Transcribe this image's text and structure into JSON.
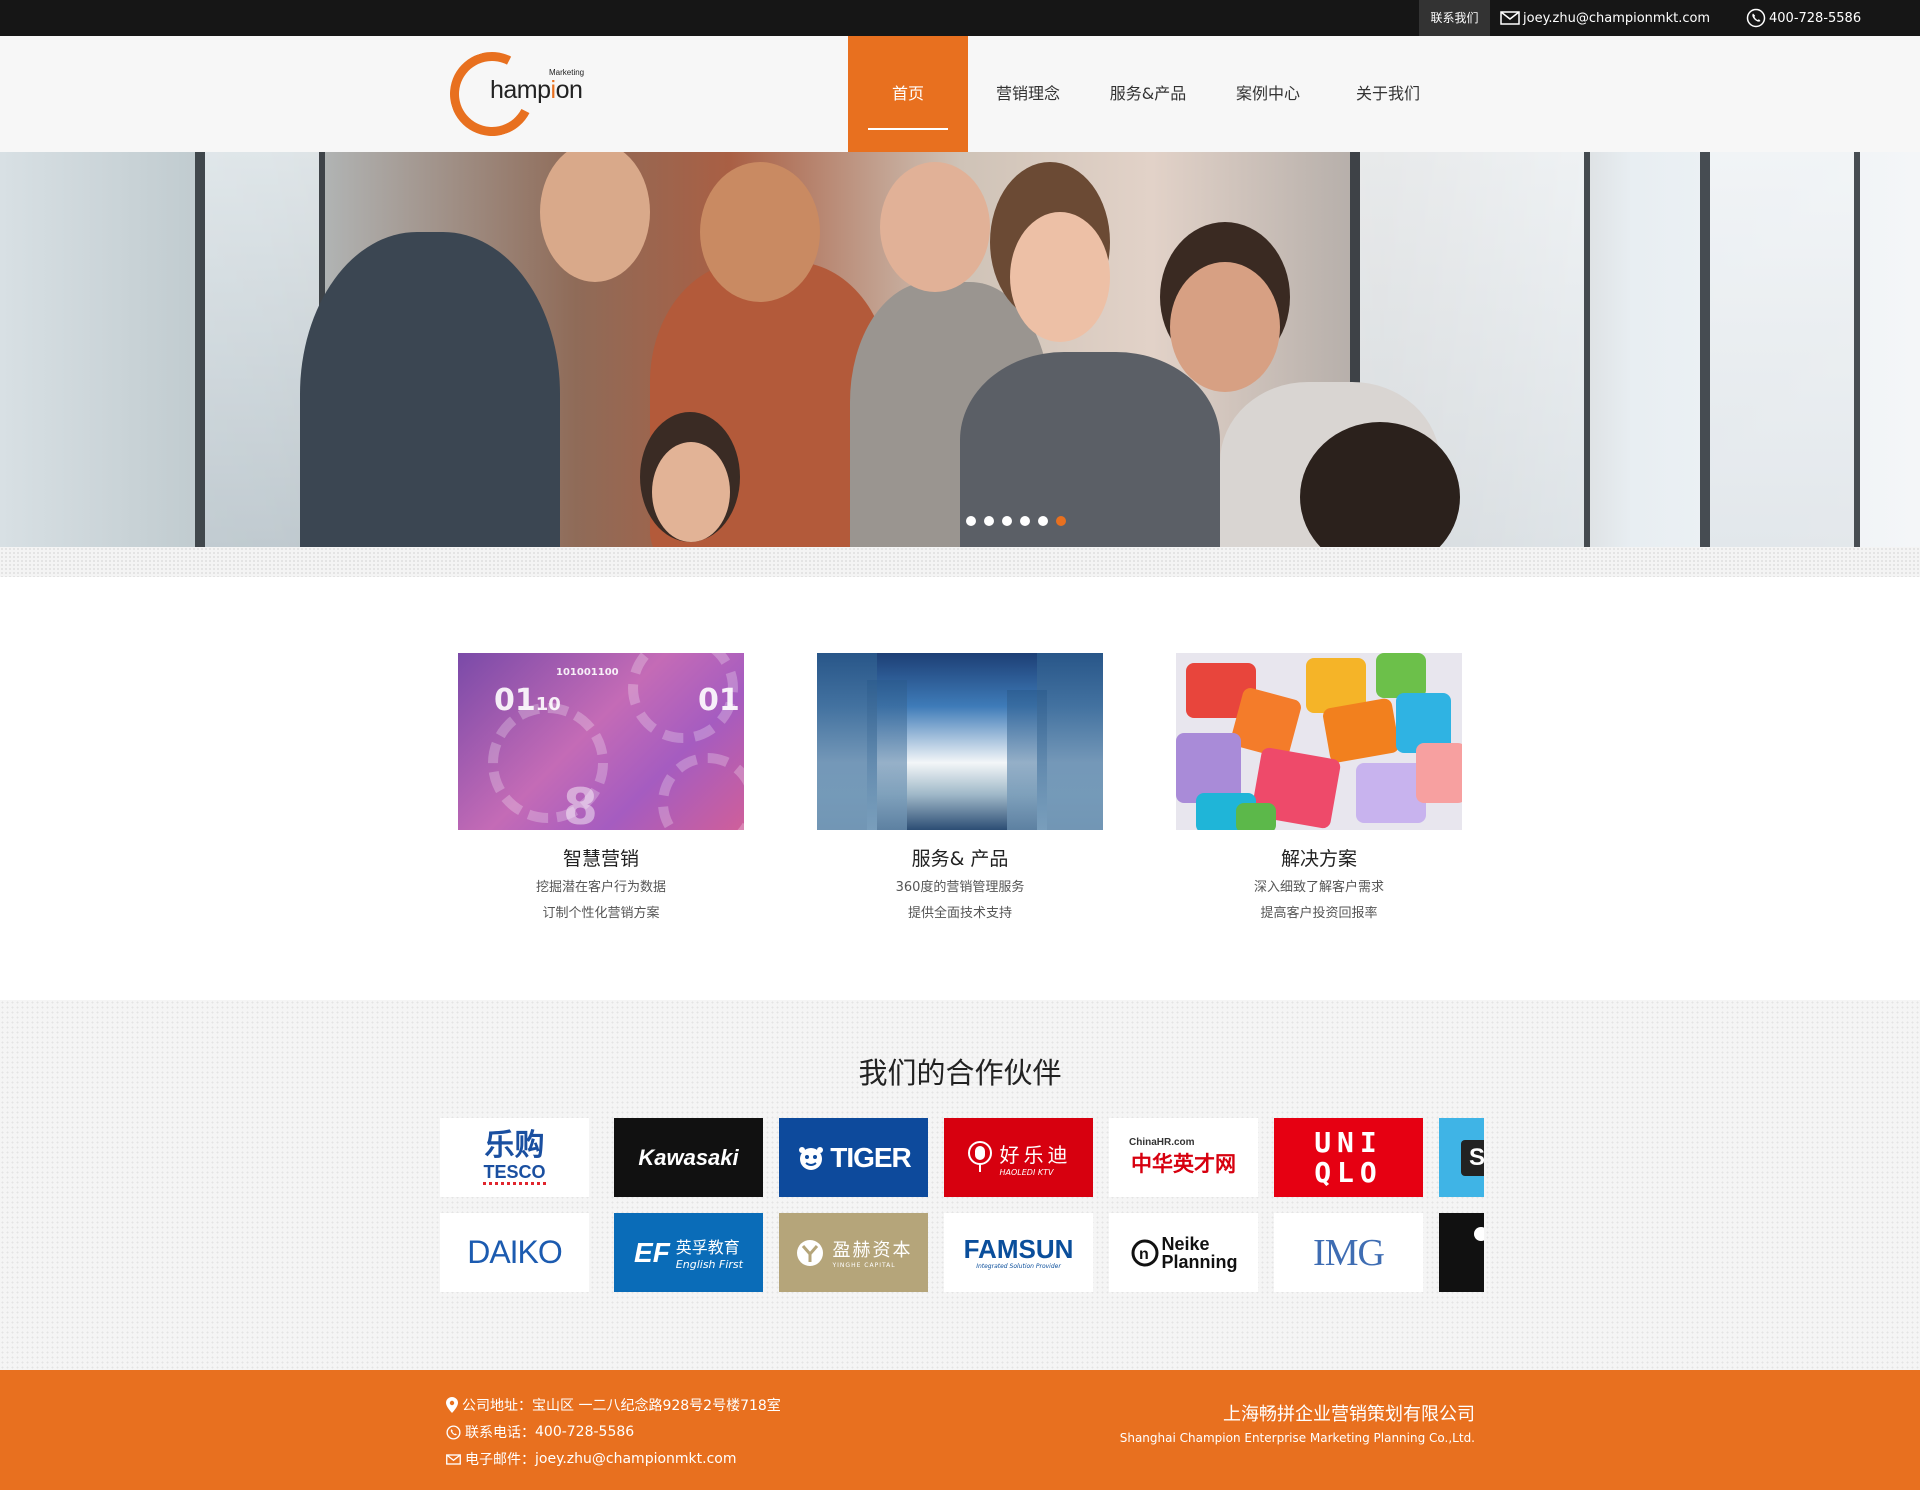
{
  "topbar": {
    "contact_label": "联系我们",
    "email": "joey.zhu@championmkt.com",
    "phone": "400-728-5586"
  },
  "logo": {
    "brand": "Champion",
    "brand_rest": "hamp",
    "brand_p": "i",
    "brand_tail": "on",
    "sub": "Marketing"
  },
  "nav": [
    {
      "label": "首页",
      "active": true
    },
    {
      "label": "营销理念"
    },
    {
      "label": "服务&产品"
    },
    {
      "label": "案例中心"
    },
    {
      "label": "关于我们"
    }
  ],
  "hero": {
    "slides": 6,
    "active_slide": 6
  },
  "features": [
    {
      "title": "智慧营销",
      "line1": "挖掘潜在客户行为数据",
      "line2": "订制个性化营销方案",
      "image_icon": "digital-gears-image"
    },
    {
      "title": "服务& 产品",
      "line1": "360度的营销管理服务",
      "line2": "提供全面技术支持",
      "image_icon": "city-skyline-image"
    },
    {
      "title": "解决方案",
      "line1": "深入细致了解客户需求",
      "line2": "提高客户投资回报率",
      "image_icon": "puzzle-pieces-image"
    }
  ],
  "partners": {
    "title": "我们的合作伙伴",
    "row1": [
      {
        "name": "乐购",
        "sub": "TESCO",
        "bg": "#ffffff"
      },
      {
        "name": "Kawasaki",
        "bg": "#111111"
      },
      {
        "name": "TIGER",
        "bg": "#0d4a9c"
      },
      {
        "name": "好乐迪",
        "sub": "HAOLEDI KTV",
        "bg": "#d7000f"
      },
      {
        "name": "中华英才网",
        "sub": "ChinaHR.com",
        "bg": "#ffffff"
      },
      {
        "name": "UNI",
        "sub": "QLO",
        "bg": "#e60012"
      },
      {
        "name": "S",
        "bg": "#3fb4e6"
      }
    ],
    "row2": [
      {
        "name": "DAIKO",
        "bg": "#ffffff"
      },
      {
        "name": "英孚教育",
        "sub": "English First",
        "mark": "EF",
        "bg": "#0a6cb8"
      },
      {
        "name": "盈赫资本",
        "sub": "YINGHE CAPITAL",
        "bg": "#b5a57a"
      },
      {
        "name": "FAMSUN",
        "sub": "Integrated Solution Provider",
        "bg": "#ffffff"
      },
      {
        "name": "Neike",
        "sub": "Planning",
        "bg": "#ffffff"
      },
      {
        "name": "IMG",
        "bg": "#ffffff"
      },
      {
        "name": "",
        "bg": "#111111"
      }
    ]
  },
  "footer": {
    "address_label": "公司地址：",
    "address": "宝山区 一二八纪念路928号2号楼718室",
    "phone_label": "联系电话：",
    "phone": "400-728-5586",
    "email_label": "电子邮件：",
    "email": "joey.zhu@championmkt.com",
    "company_cn": "上海畅拼企业营销策划有限公司",
    "company_en": "Shanghai Champion Enterprise Marketing Planning Co.,Ltd."
  },
  "colors": {
    "accent": "#e8701f",
    "topbar": "#161616"
  }
}
